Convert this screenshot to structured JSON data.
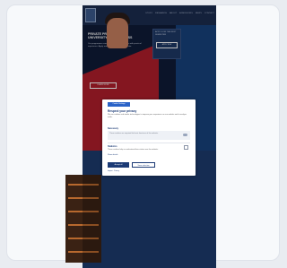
{
  "site": {
    "nav": [
      "STUDY",
      "RESEARCH",
      "ABOUT",
      "ADMISSIONS",
      "NEWS",
      "CONTACT"
    ],
    "hero_title": "PRIVATE PROFESSIONAL UNIVERSITY FOR BUSINESS",
    "hero_body": "Our programmes combine academic excellence with practical experience. Apply now for the upcoming semester.",
    "hero_cta": "LEARN MORE",
    "side_label": "APPLY FOR THE NEXT SEMESTER",
    "side_button": "APPLY NOW"
  },
  "cookie_modal": {
    "tag": "Cookie Settings",
    "title": "Respect your privacy",
    "description": "We use cookies and similar technologies to improve your experience on our website and to analyse traffic.",
    "section_necessary": "Necessary",
    "necessary_text": "These cookies are required for basic functions of the website.",
    "section_stats": "Statistics",
    "stats_text": "These cookies help us understand how visitors use the website.",
    "more_info": "Show details",
    "accept_all": "Accept all",
    "save_selection": "Save selection",
    "links": "Imprint · Privacy"
  },
  "colors": {
    "navy": "#1b2c4f",
    "red": "#b01e2b",
    "blue": "#17427d",
    "accent": "#2a63c7"
  }
}
